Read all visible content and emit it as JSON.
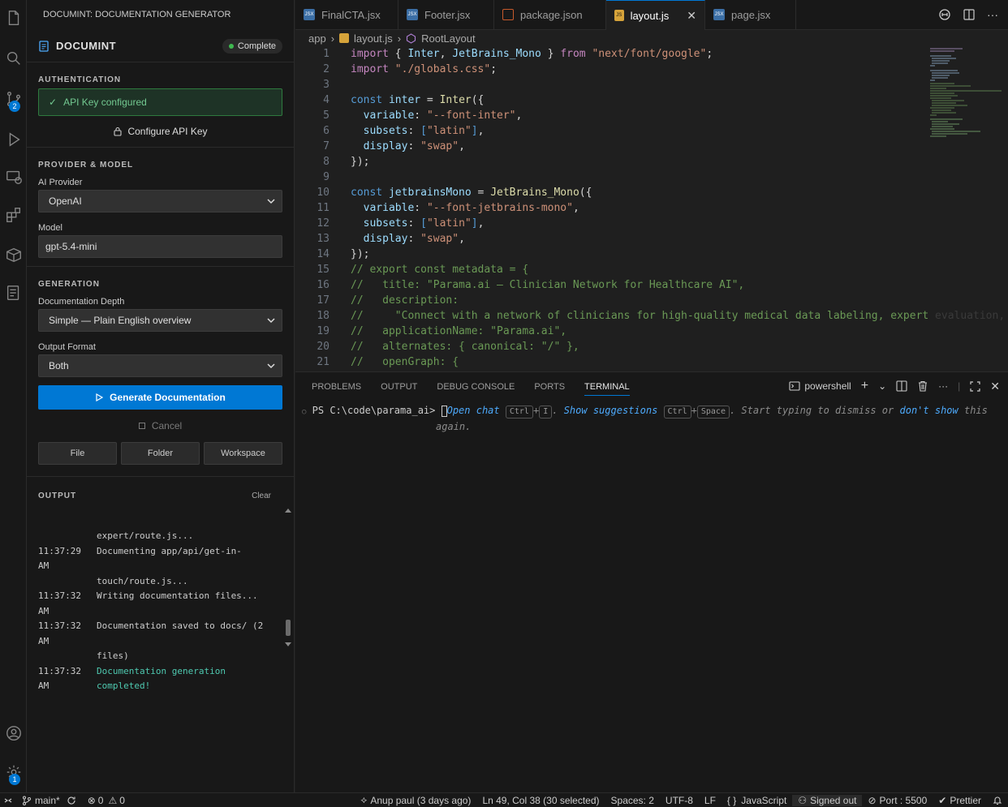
{
  "activity_bar": {
    "source_control_badge": "2",
    "settings_badge": "1"
  },
  "sidebar": {
    "view_title": "DOCUMINT: DOCUMENTATION GENERATOR",
    "app_name": "DOCUMINT",
    "status": "Complete",
    "authentication": {
      "title": "AUTHENTICATION",
      "api_status": "API Key configured",
      "configure_label": "Configure API Key"
    },
    "provider_model": {
      "title": "PROVIDER & MODEL",
      "provider_label": "AI Provider",
      "provider_value": "OpenAI",
      "model_label": "Model",
      "model_value": "gpt-5.4-mini"
    },
    "generation": {
      "title": "GENERATION",
      "depth_label": "Documentation Depth",
      "depth_value": "Simple — Plain English overview",
      "format_label": "Output Format",
      "format_value": "Both",
      "generate_label": "Generate Documentation",
      "cancel_label": "Cancel",
      "scope_buttons": [
        "File",
        "Folder",
        "Workspace"
      ]
    },
    "output": {
      "title": "OUTPUT",
      "clear_label": "Clear",
      "lines": [
        {
          "ts": "",
          "text": "expert/route.js..."
        },
        {
          "ts": "11:37:29 AM",
          "text": "Documenting app/api/get-in-"
        },
        {
          "ts": "",
          "text": "touch/route.js..."
        },
        {
          "ts": "11:37:32 AM",
          "text": "Writing documentation files..."
        },
        {
          "ts": "11:37:32 AM",
          "text": "Documentation saved to docs/ (2"
        },
        {
          "ts": "",
          "text": "files)"
        },
        {
          "ts": "11:37:32 AM",
          "text": "Documentation generation completed!"
        }
      ]
    }
  },
  "tabs": [
    {
      "label": "FinalCTA.jsx",
      "type": "jsx"
    },
    {
      "label": "Footer.jsx",
      "type": "jsx"
    },
    {
      "label": "package.json",
      "type": "json"
    },
    {
      "label": "layout.js",
      "type": "js",
      "active": true
    },
    {
      "label": "page.jsx",
      "type": "jsx"
    }
  ],
  "breadcrumb": {
    "folder": "app",
    "file": "layout.js",
    "symbol": "RootLayout"
  },
  "editor": {
    "lines": [
      {
        "n": "1"
      },
      {
        "n": "2"
      },
      {
        "n": "3"
      },
      {
        "n": "4"
      },
      {
        "n": "5"
      },
      {
        "n": "6"
      },
      {
        "n": "7"
      },
      {
        "n": "8"
      },
      {
        "n": "9"
      },
      {
        "n": "10"
      },
      {
        "n": "11"
      },
      {
        "n": "12"
      },
      {
        "n": "13"
      },
      {
        "n": "14"
      },
      {
        "n": "15"
      },
      {
        "n": "16"
      },
      {
        "n": "17"
      },
      {
        "n": "18"
      },
      {
        "n": "19"
      },
      {
        "n": "20"
      },
      {
        "n": "21"
      }
    ],
    "code": {
      "l1_a": "import",
      "l1_b": " { ",
      "l1_c": "Inter",
      "l1_d": ", ",
      "l1_e": "JetBrains_Mono",
      "l1_f": " } ",
      "l1_g": "from",
      "l1_h": " \"next/font/google\"",
      "l1_i": ";",
      "l2_a": "import",
      "l2_b": " \"./globals.css\"",
      "l2_c": ";",
      "l4_a": "const",
      "l4_b": " inter",
      "l4_c": " = ",
      "l4_d": "Inter",
      "l4_e": "({",
      "l5_a": "  variable",
      "l5_b": ": ",
      "l5_c": "\"--font-inter\"",
      "l5_d": ",",
      "l6_a": "  subsets",
      "l6_b": ": ",
      "l6_c": "[",
      "l6_d": "\"latin\"",
      "l6_e": "]",
      "l6_f": ",",
      "l7_a": "  display",
      "l7_b": ": ",
      "l7_c": "\"swap\"",
      "l7_d": ",",
      "l8_a": "});",
      "l10_a": "const",
      "l10_b": " jetbrainsMono",
      "l10_c": " = ",
      "l10_d": "JetBrains_Mono",
      "l10_e": "({",
      "l11_a": "  variable",
      "l11_b": ": ",
      "l11_c": "\"--font-jetbrains-mono\"",
      "l11_d": ",",
      "l12_a": "  subsets",
      "l12_b": ": ",
      "l12_c": "[",
      "l12_d": "\"latin\"",
      "l12_e": "]",
      "l12_f": ",",
      "l13_a": "  display",
      "l13_b": ": ",
      "l13_c": "\"swap\"",
      "l13_d": ",",
      "l14_a": "});",
      "l15": "// export const metadata = {",
      "l16": "//   title: \"Parama.ai – Clinician Network for Healthcare AI\",",
      "l17": "//   description:",
      "l18": "//     \"Connect with a network of clinicians for high-quality medical data labeling, expert",
      "l18_ghost": " evaluation,",
      "l19": "//   applicationName: \"Parama.ai\",",
      "l20": "//   alternates: { canonical: \"/\" },",
      "l21": "//   openGraph: {"
    }
  },
  "panel": {
    "tabs": [
      "PROBLEMS",
      "OUTPUT",
      "DEBUG CONSOLE",
      "PORTS",
      "TERMINAL"
    ],
    "shell": "powershell",
    "prompt": "PS C:\\code\\parama_ai>",
    "hint_open": "Open chat",
    "key_ctrl": "Ctrl",
    "plus": "+",
    "key_i": "I",
    "dot1": ".",
    "hint_show": "Show suggestions",
    "key_space": "Space",
    "hint_mid": ". Start typing to dismiss or",
    "hint_dont": "don't show",
    "hint_this": "this",
    "hint_again": "again."
  },
  "status_bar": {
    "branch": "main*",
    "errors": "0",
    "warnings": "0",
    "author": "Anup paul (3 days ago)",
    "cursor": "Ln 49, Col 38 (30 selected)",
    "spaces": "Spaces: 2",
    "encoding": "UTF-8",
    "eol": "LF",
    "language": "JavaScript",
    "account": "Signed out",
    "port": "Port : 5500",
    "formatter": "Prettier"
  },
  "colors": {
    "accent": "#0078d4",
    "success": "#3fb950",
    "background": "#1f1f1f",
    "sidebar_bg": "#181818"
  },
  "icons": [
    "files-icon",
    "search-icon",
    "source-control-icon",
    "run-debug-icon",
    "remote-explorer-icon",
    "extensions-icon",
    "docker-icon",
    "documint-icon",
    "account-icon",
    "settings-gear-icon"
  ]
}
